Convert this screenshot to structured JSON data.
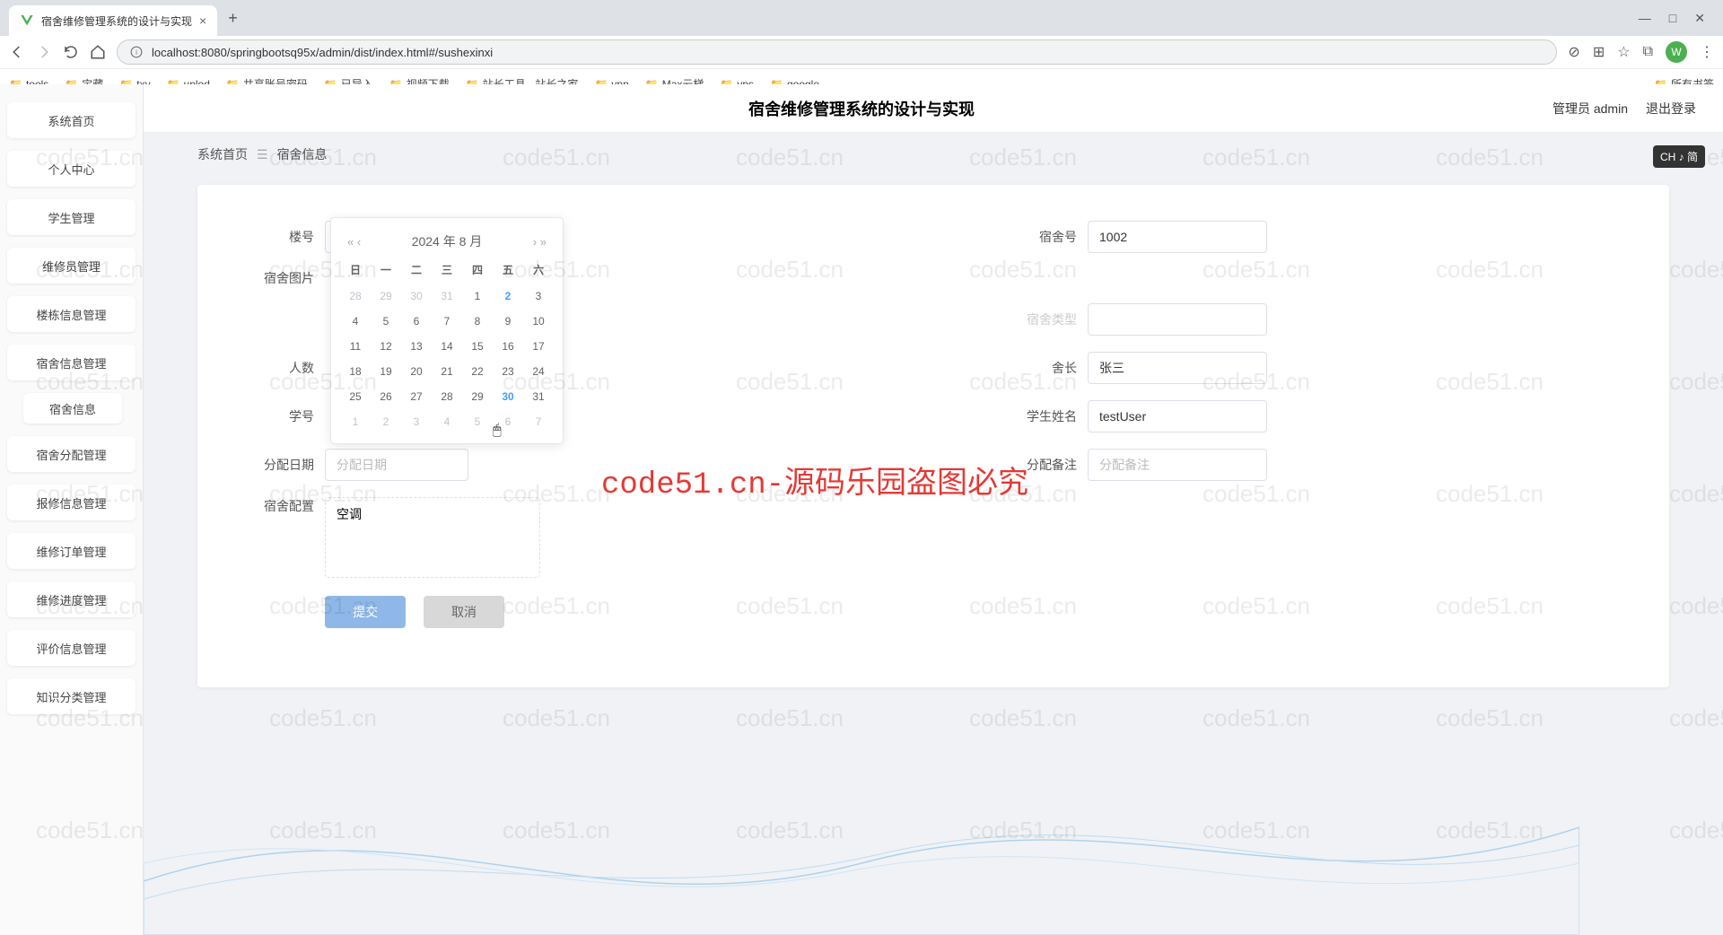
{
  "browser": {
    "tab_title": "宿舍维修管理系统的设计与实现",
    "new_tab": "+",
    "url": "localhost:8080/springbootsq95x/admin/dist/index.html#/sushexinxi",
    "avatar_letter": "W",
    "win_min": "—",
    "win_max": "□",
    "win_close": "✕",
    "bookmarks": [
      "tools",
      "宝藏",
      "txy",
      "uplod",
      "共享账号密码",
      "已导入",
      "视频下载",
      "站长工具 - 站长之家",
      "vpn",
      "Max云梯",
      "vps",
      "google"
    ],
    "bookmarks_right": "所有书签"
  },
  "sidebar": {
    "items": [
      "系统首页",
      "个人中心",
      "学生管理",
      "维修员管理",
      "楼栋信息管理",
      "宿舍信息管理"
    ],
    "child": "宿舍信息",
    "items2": [
      "宿舍分配管理",
      "报修信息管理",
      "维修订单管理",
      "维修进度管理",
      "评价信息管理",
      "知识分类管理"
    ]
  },
  "topbar": {
    "title": "宿舍维修管理系统的设计与实现",
    "admin": "管理员 admin",
    "logout": "退出登录"
  },
  "breadcrumb": {
    "home": "系统首页",
    "sep": "☰",
    "current": "宿舍信息"
  },
  "form": {
    "louhao_label": "楼号",
    "sushehao_label": "宿舍号",
    "sushehao_value": "1002",
    "tupian_label": "宿舍图片",
    "hidden1_label": "宿舍类型",
    "renshu_label": "人数",
    "shezhang_label": "舍长",
    "shezhang_value": "张三",
    "xuehao_label": "学号",
    "xueshengxingming_label": "学生姓名",
    "xueshengxingming_value": "testUser",
    "fenpeiriqi_label": "分配日期",
    "fenpeiriqi_placeholder": "分配日期",
    "fenpeibeizhu_label": "分配备注",
    "fenpeibeizhu_placeholder": "分配备注",
    "peizhi_label": "宿舍配置",
    "peizhi_value": "空调",
    "submit": "提交",
    "cancel": "取消"
  },
  "datepicker": {
    "title": "2024 年  8 月",
    "weekdays": [
      "日",
      "一",
      "二",
      "三",
      "四",
      "五",
      "六"
    ],
    "rows": [
      [
        {
          "d": "28",
          "o": 1
        },
        {
          "d": "29",
          "o": 1
        },
        {
          "d": "30",
          "o": 1
        },
        {
          "d": "31",
          "o": 1
        },
        {
          "d": "1"
        },
        {
          "d": "2",
          "t": 1
        },
        {
          "d": "3"
        }
      ],
      [
        {
          "d": "4"
        },
        {
          "d": "5"
        },
        {
          "d": "6"
        },
        {
          "d": "7"
        },
        {
          "d": "8"
        },
        {
          "d": "9"
        },
        {
          "d": "10"
        }
      ],
      [
        {
          "d": "11"
        },
        {
          "d": "12"
        },
        {
          "d": "13"
        },
        {
          "d": "14"
        },
        {
          "d": "15"
        },
        {
          "d": "16"
        },
        {
          "d": "17"
        }
      ],
      [
        {
          "d": "18"
        },
        {
          "d": "19"
        },
        {
          "d": "20"
        },
        {
          "d": "21"
        },
        {
          "d": "22"
        },
        {
          "d": "23"
        },
        {
          "d": "24"
        }
      ],
      [
        {
          "d": "25"
        },
        {
          "d": "26"
        },
        {
          "d": "27"
        },
        {
          "d": "28"
        },
        {
          "d": "29"
        },
        {
          "d": "30",
          "t": 1
        },
        {
          "d": "31"
        }
      ],
      [
        {
          "d": "1",
          "o": 1
        },
        {
          "d": "2",
          "o": 1
        },
        {
          "d": "3",
          "o": 1
        },
        {
          "d": "4",
          "o": 1
        },
        {
          "d": "5",
          "o": 1
        },
        {
          "d": "6",
          "o": 1
        },
        {
          "d": "7",
          "o": 1
        }
      ]
    ]
  },
  "watermark_text": "code51.cn",
  "watermark_red": "code51.cn-源码乐园盗图必究",
  "ime_badge": "CH ♪ 简"
}
